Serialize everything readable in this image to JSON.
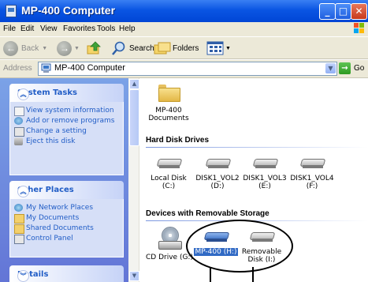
{
  "window": {
    "title": "MP-400 Computer"
  },
  "menu": [
    "File",
    "Edit",
    "View",
    "Favorites",
    "Tools",
    "Help"
  ],
  "toolbar": {
    "back": "Back",
    "search": "Search",
    "folders": "Folders"
  },
  "address": {
    "label": "Address",
    "value": "MP-400 Computer",
    "go": "Go"
  },
  "tasks": {
    "system": {
      "title": "System Tasks",
      "items": [
        "View system information",
        "Add or remove programs",
        "Change a setting",
        "Eject this disk"
      ]
    },
    "other": {
      "title": "Other Places",
      "items": [
        "My Network Places",
        "My Documents",
        "Shared Documents",
        "Control Panel"
      ]
    },
    "details": {
      "title": "Details"
    }
  },
  "content": {
    "docs": {
      "label": "MP-400 Documents"
    },
    "hdd_group": "Hard Disk Drives",
    "drives": [
      {
        "label": "Local Disk (C:)"
      },
      {
        "label": "DISK1_VOL2 (D:)"
      },
      {
        "label": "DISK1_VOL3 (E:)"
      },
      {
        "label": "DISK1_VOL4 (F:)"
      }
    ],
    "removable_group": "Devices with Removable Storage",
    "removable": [
      {
        "label": "CD Drive (G:)"
      },
      {
        "label": "MP-400 (H:)",
        "selected": true
      },
      {
        "label": "Removable Disk (I:)"
      }
    ]
  },
  "colors": {
    "titlebar": "#0a55e3",
    "taskpane": "#6f8ee0",
    "link": "#215dc6",
    "selection": "#316ac5"
  }
}
